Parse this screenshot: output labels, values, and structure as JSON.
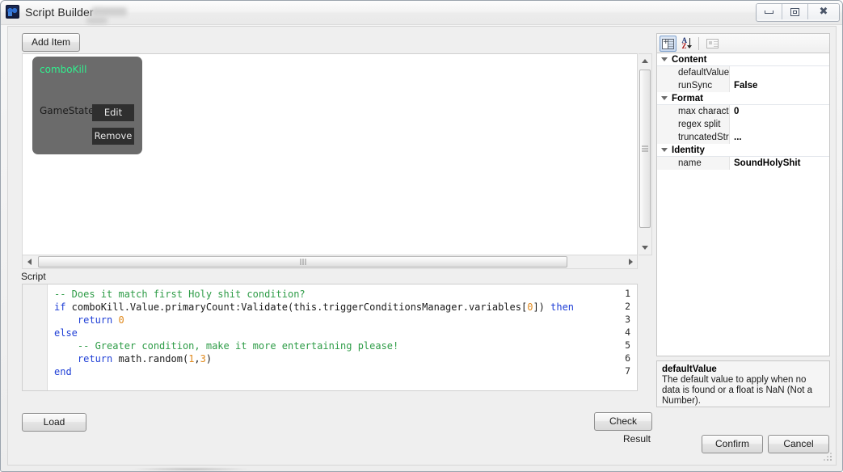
{
  "window": {
    "title": "Script Builder",
    "icon": "app-icon",
    "controls": {
      "minimize": "minimize-icon",
      "restore": "restore-icon",
      "close": "close-icon"
    }
  },
  "toolbar": {
    "add_item_label": "Add Item"
  },
  "canvas": {
    "node": {
      "title": "comboKill",
      "field_label": "GameState",
      "edit_label": "Edit",
      "remove_label": "Remove"
    },
    "scroll": {
      "up_icon": "chevron-up-icon",
      "down_icon": "chevron-down-icon",
      "left_icon": "chevron-left-icon",
      "right_icon": "chevron-right-icon"
    }
  },
  "script": {
    "label": "Script",
    "lines": [
      {
        "n": "1",
        "tokens": [
          {
            "t": "comment",
            "v": "-- Does it match first Holy shit condition?"
          }
        ]
      },
      {
        "n": "2",
        "tokens": [
          {
            "t": "keyword",
            "v": "if"
          },
          {
            "t": "plain",
            "v": " comboKill.Value.primaryCount:Validate(this.triggerConditionsManager.variables["
          },
          {
            "t": "number",
            "v": "0"
          },
          {
            "t": "plain",
            "v": "]) "
          },
          {
            "t": "keyword",
            "v": "then"
          }
        ]
      },
      {
        "n": "3",
        "tokens": [
          {
            "t": "plain",
            "v": "    "
          },
          {
            "t": "keyword",
            "v": "return"
          },
          {
            "t": "plain",
            "v": " "
          },
          {
            "t": "number",
            "v": "0"
          }
        ]
      },
      {
        "n": "4",
        "tokens": [
          {
            "t": "keyword",
            "v": "else"
          }
        ]
      },
      {
        "n": "5",
        "tokens": [
          {
            "t": "plain",
            "v": "    "
          },
          {
            "t": "comment",
            "v": "-- Greater condition, make it more entertaining please!"
          }
        ]
      },
      {
        "n": "6",
        "tokens": [
          {
            "t": "plain",
            "v": "    "
          },
          {
            "t": "keyword",
            "v": "return"
          },
          {
            "t": "plain",
            "v": " math.random("
          },
          {
            "t": "number",
            "v": "1"
          },
          {
            "t": "plain",
            "v": ","
          },
          {
            "t": "number",
            "v": "3"
          },
          {
            "t": "plain",
            "v": ")"
          }
        ]
      },
      {
        "n": "7",
        "tokens": [
          {
            "t": "keyword",
            "v": "end"
          }
        ]
      }
    ]
  },
  "footer": {
    "load_label": "Load",
    "check_label": "Check",
    "result_label": "Result",
    "confirm_label": "Confirm",
    "cancel_label": "Cancel"
  },
  "property_grid": {
    "toolbar": {
      "categorized_icon": "categorized-view-icon",
      "alphabetical_icon": "alphabetical-sort-icon",
      "property_pages_icon": "property-pages-icon"
    },
    "rows": [
      {
        "kind": "category",
        "name": "Content"
      },
      {
        "kind": "property",
        "name": "defaultValue",
        "value": ""
      },
      {
        "kind": "property",
        "name": "runSync",
        "value": "False"
      },
      {
        "kind": "category",
        "name": "Format"
      },
      {
        "kind": "property",
        "name": "max characters",
        "value": "0"
      },
      {
        "kind": "property",
        "name": "regex split",
        "value": ""
      },
      {
        "kind": "property",
        "name": "truncatedString",
        "value": "..."
      },
      {
        "kind": "category",
        "name": "Identity"
      },
      {
        "kind": "property",
        "name": "name",
        "value": "SoundHolyShit"
      }
    ],
    "description": {
      "title": "defaultValue",
      "body": "The default value to apply when no data is found or a float is NaN (Not a Number)."
    }
  },
  "colors": {
    "node_background": "#6b6b6b",
    "node_title": "#31ef8e",
    "comment": "#2e9c47",
    "keyword": "#1f3fd6",
    "number": "#e08a1e"
  }
}
